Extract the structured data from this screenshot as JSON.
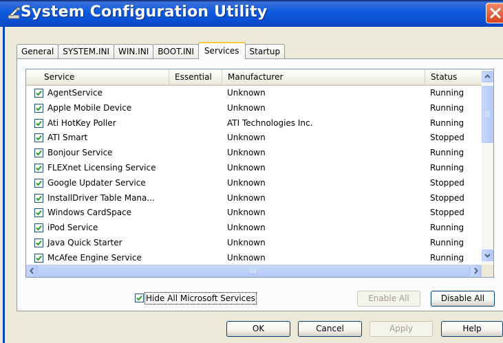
{
  "window": {
    "title": "System Configuration Utility"
  },
  "tabs": [
    {
      "label": "General"
    },
    {
      "label": "SYSTEM.INI"
    },
    {
      "label": "WIN.INI"
    },
    {
      "label": "BOOT.INI"
    },
    {
      "label": "Services",
      "active": true
    },
    {
      "label": "Startup"
    }
  ],
  "columns": {
    "service": "Service",
    "essential": "Essential",
    "manufacturer": "Manufacturer",
    "status": "Status"
  },
  "services": [
    {
      "name": "AgentService",
      "essential": "",
      "manufacturer": "Unknown",
      "status": "Running",
      "checked": true
    },
    {
      "name": "Apple Mobile Device",
      "essential": "",
      "manufacturer": "Unknown",
      "status": "Running",
      "checked": true
    },
    {
      "name": "Ati HotKey Poller",
      "essential": "",
      "manufacturer": "ATI Technologies Inc.",
      "status": "Running",
      "checked": true
    },
    {
      "name": "ATI Smart",
      "essential": "",
      "manufacturer": "Unknown",
      "status": "Stopped",
      "checked": true
    },
    {
      "name": "Bonjour Service",
      "essential": "",
      "manufacturer": "Unknown",
      "status": "Running",
      "checked": true
    },
    {
      "name": "FLEXnet Licensing Service",
      "essential": "",
      "manufacturer": "Unknown",
      "status": "Running",
      "checked": true
    },
    {
      "name": "Google Updater Service",
      "essential": "",
      "manufacturer": "Unknown",
      "status": "Stopped",
      "checked": true
    },
    {
      "name": "InstallDriver Table Mana...",
      "essential": "",
      "manufacturer": "Unknown",
      "status": "Stopped",
      "checked": true
    },
    {
      "name": "Windows CardSpace",
      "essential": "",
      "manufacturer": "Unknown",
      "status": "Stopped",
      "checked": true
    },
    {
      "name": "iPod Service",
      "essential": "",
      "manufacturer": "Unknown",
      "status": "Running",
      "checked": true
    },
    {
      "name": "Java Quick Starter",
      "essential": "",
      "manufacturer": "Unknown",
      "status": "Running",
      "checked": true
    },
    {
      "name": "McAfee Engine Service",
      "essential": "",
      "manufacturer": "Unknown",
      "status": "Running",
      "checked": true
    }
  ],
  "hide_ms": {
    "label": "Hide All Microsoft Services",
    "checked": true
  },
  "buttons": {
    "enable_all": "Enable All",
    "disable_all": "Disable All",
    "ok": "OK",
    "cancel": "Cancel",
    "apply": "Apply",
    "help": "Help"
  },
  "colors": {
    "titlebar": "#0d5be0",
    "active_tab_accent": "#ffc83c",
    "close_button": "#d8431c",
    "checkmark": "#21a121"
  }
}
